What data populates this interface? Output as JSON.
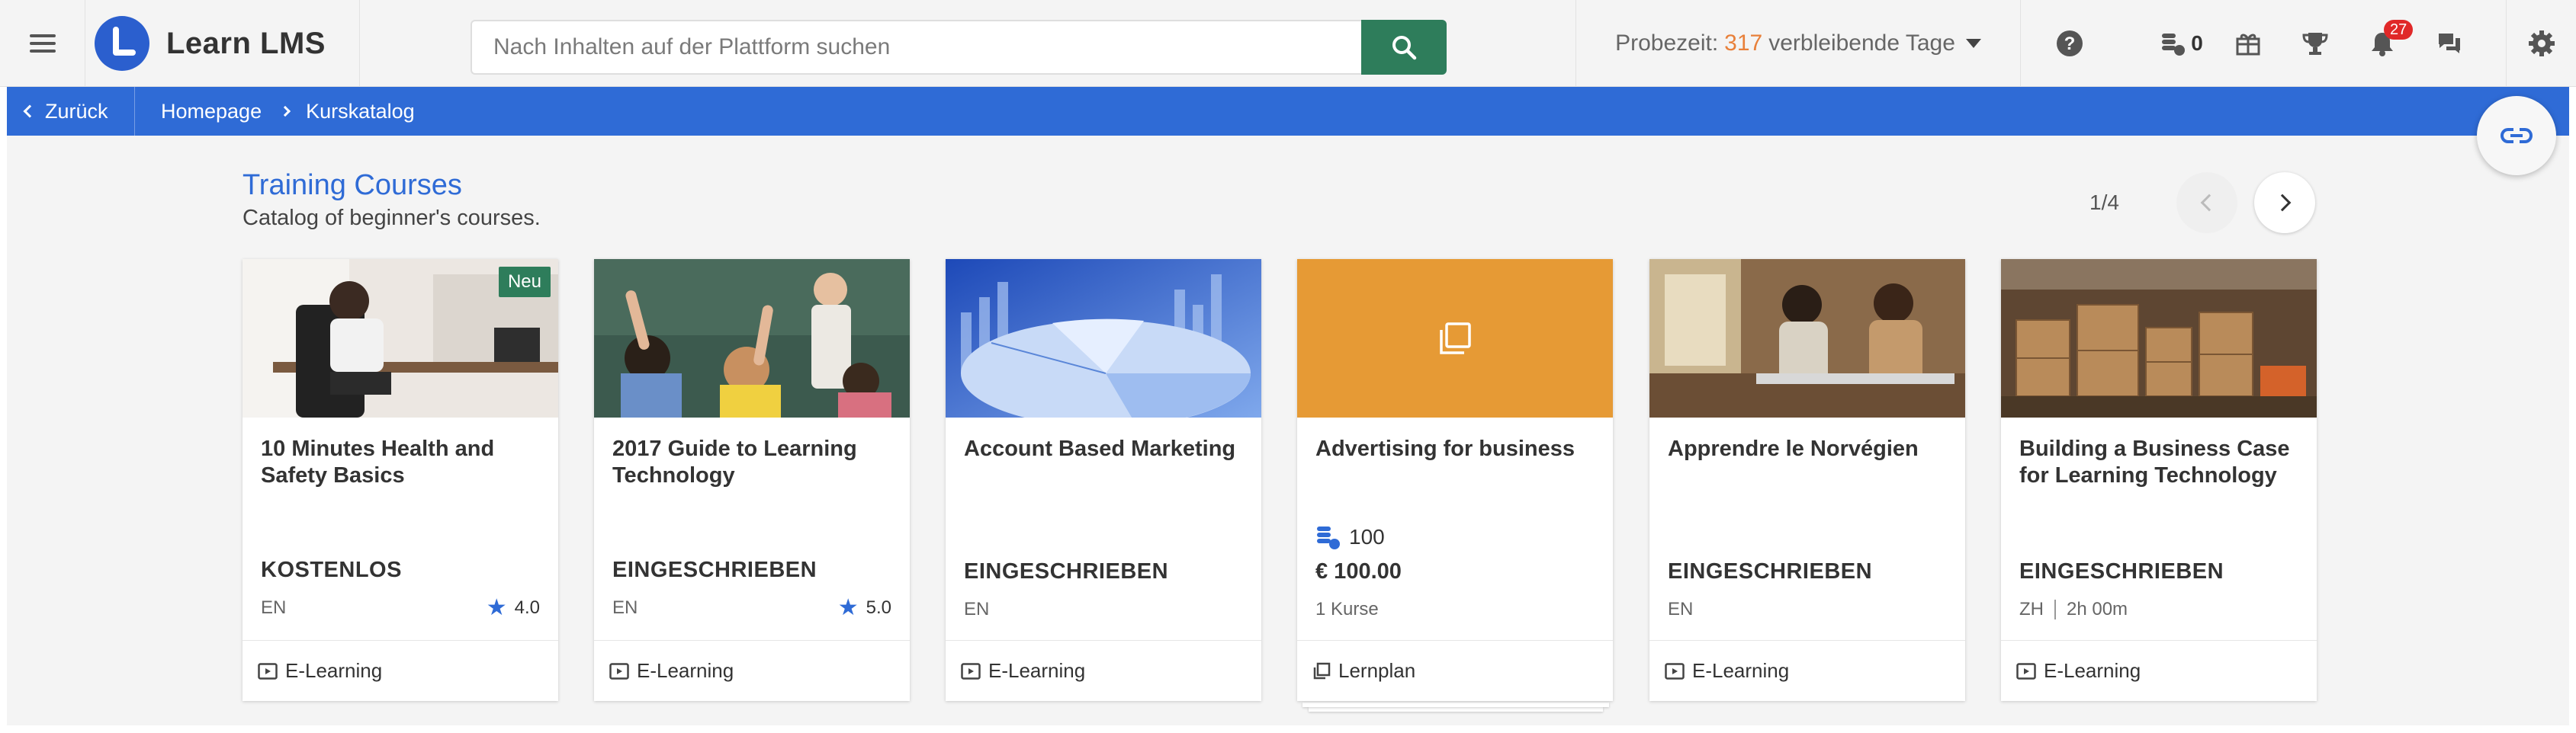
{
  "app": {
    "name": "Learn LMS",
    "logo_letter": "L"
  },
  "search": {
    "placeholder": "Nach Inhalten auf der Plattform suchen",
    "value": ""
  },
  "trial": {
    "prefix": "Probezeit:",
    "days": "317",
    "suffix": "verbleibende Tage"
  },
  "header_icons": {
    "coins_count": "0",
    "notifications_count": "27"
  },
  "breadcrumb": {
    "back_label": "Zurück",
    "items": [
      "Homepage",
      "Kurskatalog"
    ]
  },
  "section": {
    "title": "Training Courses",
    "subtitle": "Catalog of beginner's courses.",
    "pager": "1/4"
  },
  "colors": {
    "brand": "#2b5fce",
    "breadcrumb_bg": "#2f6bd6",
    "search_button": "#2e7d5b",
    "trial_days": "#e8803a",
    "notification_badge": "#e02828",
    "learning_plan_tile": "#e69a35"
  },
  "cards": [
    {
      "title": "10 Minutes Health and Safety Basics",
      "badge": "Neu",
      "status": "KOSTENLOS",
      "lang": "EN",
      "rating": "4.0",
      "type": "E-Learning",
      "image": "person-at-desk-stretching"
    },
    {
      "title": "2017 Guide to Learning Technology",
      "status": "EINGESCHRIEBEN",
      "lang": "EN",
      "rating": "5.0",
      "type": "E-Learning",
      "image": "classroom-raised-hands"
    },
    {
      "title": "Account Based Marketing",
      "status": "EINGESCHRIEBEN",
      "lang": "EN",
      "type": "E-Learning",
      "image": "blue-pie-chart"
    },
    {
      "title": "Advertising for business",
      "coins": "100",
      "price": "€ 100.00",
      "courses": "1 Kurse",
      "type": "Lernplan",
      "image": "learning-plan-tile"
    },
    {
      "title": "Apprendre le Norvégien",
      "status": "EINGESCHRIEBEN",
      "lang": "EN",
      "type": "E-Learning",
      "image": "two-men-talking"
    },
    {
      "title": "Building a Business Case for Learning Technology",
      "status": "EINGESCHRIEBEN",
      "lang": "ZH",
      "duration": "2h 00m",
      "type": "E-Learning",
      "image": "warehouse-boxes"
    }
  ]
}
